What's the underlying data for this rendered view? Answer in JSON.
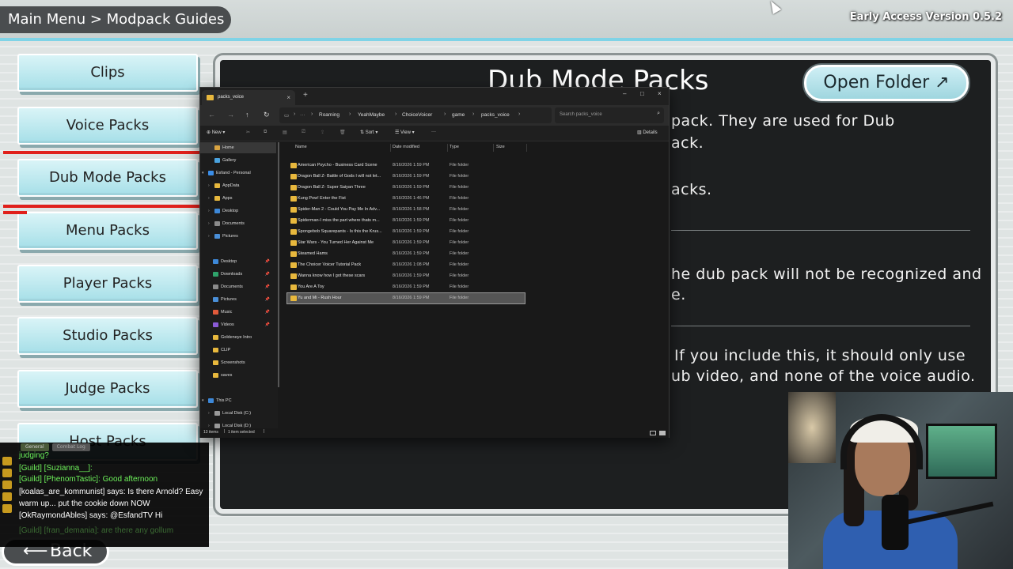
{
  "game": {
    "breadcrumb": "Main Menu > Modpack Guides",
    "version": "Early Access Version 0.5.2",
    "menu": [
      "Clips",
      "Voice Packs",
      "Dub Mode Packs",
      "Menu Packs",
      "Player Packs",
      "Studio Packs",
      "Judge Packs",
      "Host Packs"
    ],
    "selected_index": 2,
    "panel": {
      "title": "Dub Mode Packs",
      "open_folder": "Open Folder ↗",
      "lines": [
        "pack. They are used for Dub",
        "ack.",
        "acks.",
        "he dub pack will not be recognized and",
        "e.",
        "If you include this, it should only use",
        "ub video, and none of the voice audio."
      ]
    },
    "back": "Back",
    "back_arrow": "⟵"
  },
  "chat": {
    "tabs": [
      "General",
      "Combat Log"
    ],
    "lines": [
      "judging?",
      "[Guild] [Suzianna__]:",
      "[Guild] [PhenomTastic]: Good afternoon",
      "[koalas_are_kommunist] says: Is there Arnold? Easy",
      "warm up... put the cookie down NOW",
      "[OkRaymondAbles] says: @EsfandTV Hi",
      "[Guild] [fran_demania]: are there any gollum"
    ]
  },
  "explorer": {
    "tab_title": "packs_voice",
    "tab_close": "×",
    "new_tab": "+",
    "window_buttons": [
      "–",
      "□",
      "×"
    ],
    "nav_glyphs": [
      "←",
      "→",
      "↑",
      "↻"
    ],
    "breadcrumbs": [
      "Roaming",
      "YeahMaybe",
      "ChoiceVoicer",
      "game",
      "packs_voice"
    ],
    "search_placeholder": "Search packs_voice",
    "commands": {
      "new": "New",
      "sort": "Sort",
      "view": "View",
      "more": "···",
      "details": "Details"
    },
    "columns": [
      "Name",
      "Date modified",
      "Type",
      "Size"
    ],
    "nav_items": [
      {
        "label": "Home",
        "icon": "home-icon",
        "color": "#d9a441"
      },
      {
        "label": "Gallery",
        "icon": "gallery-icon",
        "color": "#4aa3df"
      },
      {
        "label": "Esfand - Personal",
        "icon": "cloud-icon",
        "color": "#3b8ee8"
      },
      {
        "label": "AppData",
        "icon": "folder-icon",
        "color": "#e8b83d"
      },
      {
        "label": "Apps",
        "icon": "folder-icon",
        "color": "#e8b83d"
      },
      {
        "label": "Desktop",
        "icon": "desktop-icon",
        "color": "#3d88d8"
      },
      {
        "label": "Documents",
        "icon": "documents-icon",
        "color": "#8a8a8a"
      },
      {
        "label": "Pictures",
        "icon": "pictures-icon",
        "color": "#4a8fd8"
      },
      {
        "label": "Desktop",
        "icon": "desktop-icon",
        "color": "#3d88d8"
      },
      {
        "label": "Downloads",
        "icon": "downloads-icon",
        "color": "#2fa36b"
      },
      {
        "label": "Documents",
        "icon": "documents-icon",
        "color": "#8a8a8a"
      },
      {
        "label": "Pictures",
        "icon": "pictures-icon",
        "color": "#4a8fd8"
      },
      {
        "label": "Music",
        "icon": "music-icon",
        "color": "#e05a3b"
      },
      {
        "label": "Videos",
        "icon": "videos-icon",
        "color": "#8b5bd6"
      },
      {
        "label": "Goldeneye Intro",
        "icon": "folder-icon",
        "color": "#e8b83d"
      },
      {
        "label": "CLIP",
        "icon": "folder-icon",
        "color": "#e8b83d"
      },
      {
        "label": "Screenshots",
        "icon": "folder-icon",
        "color": "#e8b83d"
      },
      {
        "label": "saves",
        "icon": "folder-icon",
        "color": "#e8b83d"
      },
      {
        "label": "This PC",
        "icon": "pc-icon",
        "color": "#3d88d8"
      },
      {
        "label": "Local Disk (C:)",
        "icon": "disk-icon",
        "color": "#9a9a9a"
      },
      {
        "label": "Local Disk (D:)",
        "icon": "disk-icon",
        "color": "#9a9a9a"
      }
    ],
    "files": [
      {
        "name": "American Psycho - Business Card Scene",
        "date": "8/16/2026 1:59 PM",
        "type": "File folder"
      },
      {
        "name": "Dragon Ball Z- Battle of Gods I will not let...",
        "date": "8/16/2026 1:59 PM",
        "type": "File folder"
      },
      {
        "name": "Dragon Ball Z- Super Saiyan Three",
        "date": "8/16/2026 1:59 PM",
        "type": "File folder"
      },
      {
        "name": "Kung Pow! Enter the Fist",
        "date": "8/16/2026 1:46 PM",
        "type": "File folder"
      },
      {
        "name": "Spider-Man 2 - Could You Pay Me In Adv...",
        "date": "8/16/2026 1:58 PM",
        "type": "File folder"
      },
      {
        "name": "Spiderman-I miss the part where thats m...",
        "date": "8/16/2026 1:59 PM",
        "type": "File folder"
      },
      {
        "name": "Spongebob Squarepants - Is this the Krus...",
        "date": "8/16/2026 1:59 PM",
        "type": "File folder"
      },
      {
        "name": "Star Wars - You Turned Her Against Me",
        "date": "8/16/2026 1:59 PM",
        "type": "File folder"
      },
      {
        "name": "Steamed Hams",
        "date": "8/16/2026 1:59 PM",
        "type": "File folder"
      },
      {
        "name": "The Choicer Voicer Tutorial Pack",
        "date": "8/16/2026 1:08 PM",
        "type": "File folder"
      },
      {
        "name": "Wanna know how I got these scars",
        "date": "8/16/2026 1:59 PM",
        "type": "File folder"
      },
      {
        "name": "You Are A Toy",
        "date": "8/16/2026 1:59 PM",
        "type": "File folder"
      },
      {
        "name": "Yu and Mi - Rush Hour",
        "date": "8/16/2026 1:59 PM",
        "type": "File folder"
      }
    ],
    "selected_file_index": 12,
    "status": {
      "items": "13 items",
      "selected": "1 item selected"
    }
  }
}
